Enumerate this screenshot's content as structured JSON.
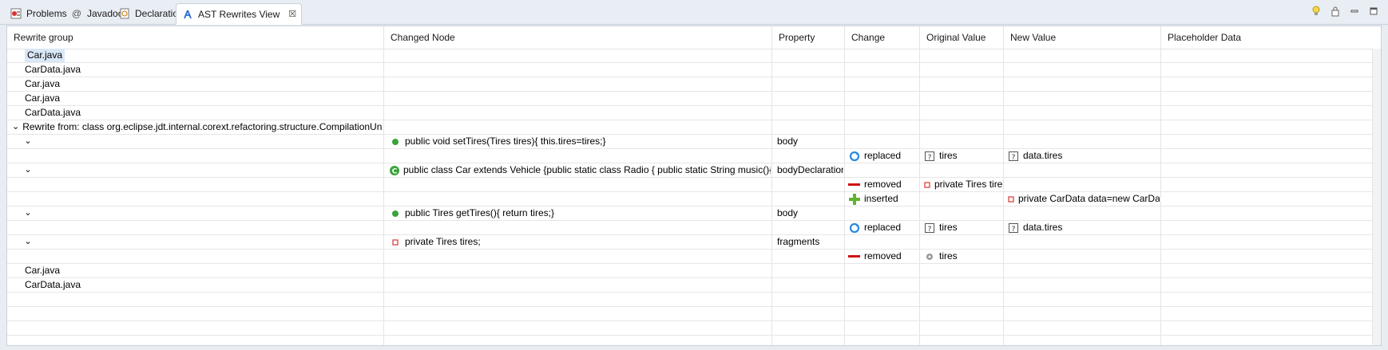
{
  "tabs": [
    {
      "label": "Problems",
      "icon": "problems-icon"
    },
    {
      "label": "Javadoc",
      "icon": "javadoc-icon"
    },
    {
      "label": "Declaration",
      "icon": "declaration-icon"
    },
    {
      "label": "AST Rewrites View",
      "icon": "ast-view-icon",
      "active": true
    }
  ],
  "tools": [
    "lightbulb-icon",
    "lock-icon",
    "minimize-icon",
    "maximize-icon"
  ],
  "columns": [
    "Rewrite group",
    "Changed Node",
    "Property",
    "Change",
    "Original Value",
    "New Value",
    "Placeholder Data"
  ],
  "rows": [
    {
      "group": "Car.java",
      "selected": true
    },
    {
      "group": "CarData.java"
    },
    {
      "group": "Car.java"
    },
    {
      "group": "Car.java"
    },
    {
      "group": "CarData.java"
    },
    {
      "group": "Rewrite from: class org.eclipse.jdt.internal.corext.refactoring.structure.CompilationUnitRewrite",
      "chevron": true,
      "indent": 0
    },
    {
      "chevron": true,
      "indent": 1,
      "node": "public void setTires(Tires tires){  this.tires=tires;}",
      "node_icon": "method-icon",
      "property": "body"
    },
    {
      "change": "replaced",
      "change_icon": "replaced-icon",
      "original": "tires",
      "original_icon": "unknown-node-icon",
      "new": "data.tires",
      "new_icon": "unknown-node-icon"
    },
    {
      "chevron": true,
      "indent": 1,
      "node": "public class Car extends Vehicle {public static class Radio {    public static String music(){      retur...",
      "node_icon": "class-icon",
      "property": "bodyDeclarations"
    },
    {
      "change": "removed",
      "change_icon": "removed-icon",
      "original": "private Tires tires;",
      "original_icon": "field-icon"
    },
    {
      "change": "inserted",
      "change_icon": "inserted-icon",
      "new": "private CarData data=new CarData();",
      "new_icon": "field-icon"
    },
    {
      "chevron": true,
      "indent": 1,
      "node": "public Tires getTires(){  return tires;}",
      "node_icon": "method-icon",
      "property": "body"
    },
    {
      "change": "replaced",
      "change_icon": "replaced-icon",
      "original": "tires",
      "original_icon": "unknown-node-icon",
      "new": "data.tires",
      "new_icon": "unknown-node-icon"
    },
    {
      "chevron": true,
      "indent": 1,
      "node": "private Tires tires;",
      "node_icon": "field-icon",
      "property": "fragments"
    },
    {
      "change": "removed",
      "change_icon": "removed-icon",
      "original": "tires",
      "original_icon": "variable-icon"
    },
    {
      "group": "Car.java"
    },
    {
      "group": "CarData.java"
    },
    {},
    {},
    {},
    {},
    {}
  ]
}
